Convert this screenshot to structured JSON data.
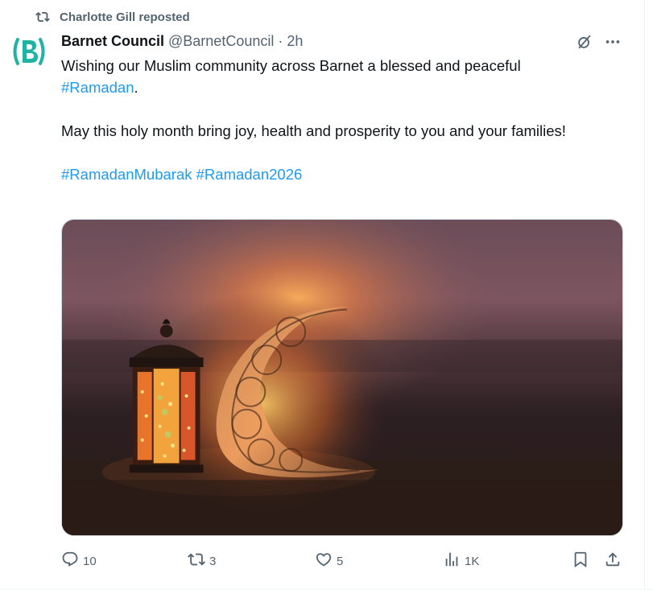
{
  "repost": {
    "icon": "repost-icon",
    "text": "Charlotte Gill reposted"
  },
  "author": {
    "avatar_icon": "barnet-council-logo",
    "avatar_text": "(B)",
    "display_name": "Barnet Council",
    "handle": "@BarnetCouncil",
    "separator": "·",
    "time": "2h"
  },
  "header_icons": {
    "grok": "grok-icon",
    "more": "more-icon"
  },
  "post": {
    "line1_text": "Wishing our Muslim community across Barnet a blessed and peaceful",
    "line1_hashtag": "#Ramadan",
    "line1_end": ".",
    "line2": "May this holy month bring joy, health and prosperity to you and your families!",
    "hashtag_a": "#RamadanMubarak",
    "hashtag_b": "#Ramadan2026"
  },
  "media": {
    "icon": "ramadan-lantern-crescent-image"
  },
  "actions": {
    "replies": {
      "icon": "reply-icon",
      "count": "10"
    },
    "reposts": {
      "icon": "repost-icon",
      "count": "3"
    },
    "likes": {
      "icon": "heart-icon",
      "count": "5"
    },
    "views": {
      "icon": "views-icon",
      "count": "1K"
    },
    "bookmark": {
      "icon": "bookmark-icon"
    },
    "share": {
      "icon": "share-icon"
    }
  },
  "colors": {
    "text": "#0f1419",
    "secondary": "#536471",
    "link": "#1d9bf0",
    "avatar_teal": "#1fb3a3",
    "border": "#cfd9de"
  }
}
